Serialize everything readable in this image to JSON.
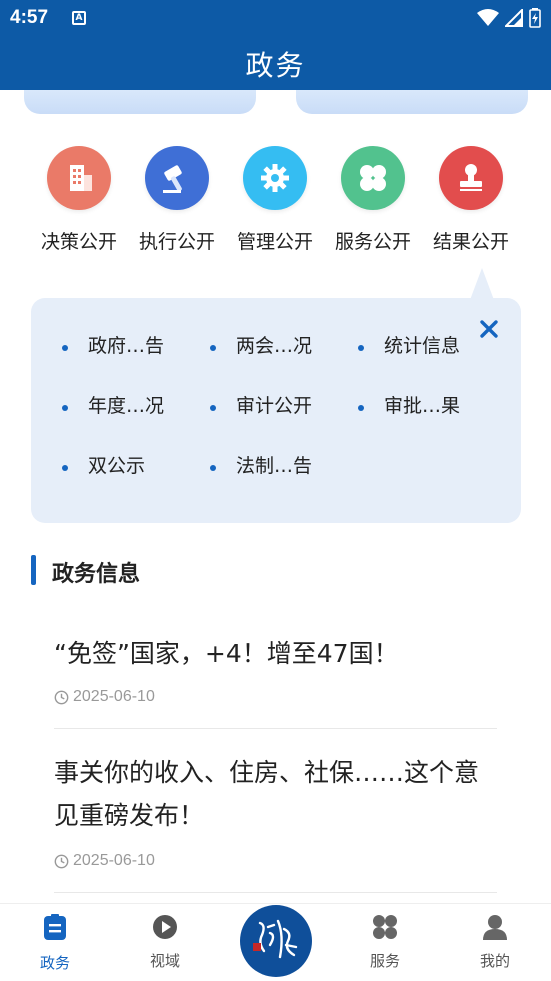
{
  "status_bar": {
    "time": "4:57",
    "a_badge": "A"
  },
  "header": {
    "title": "政务"
  },
  "nav_items": [
    {
      "label": "决策公开",
      "icon": "building-icon",
      "color": "#e96c5c"
    },
    {
      "label": "执行公开",
      "icon": "gavel-icon",
      "color": "#3f6fd6"
    },
    {
      "label": "管理公开",
      "icon": "gear-icon",
      "color": "#33b8f0"
    },
    {
      "label": "服务公开",
      "icon": "clover-icon",
      "color": "#4fbf8a"
    },
    {
      "label": "结果公开",
      "icon": "stamp-icon",
      "color": "#e04848"
    }
  ],
  "panel": {
    "items": [
      "政府…告",
      "两会…况",
      "统计信息",
      "年度…况",
      "审计公开",
      "审批…果",
      "双公示",
      "法制…告"
    ]
  },
  "section": {
    "title": "政务信息"
  },
  "news": [
    {
      "title": "“免签”国家，+4！增至47国！",
      "date": "2025-06-10"
    },
    {
      "title": "事关你的收入、住房、社保……这个意见重磅发布！",
      "date": "2025-06-10"
    }
  ],
  "bottom_nav": {
    "tabs": [
      {
        "label": "政务",
        "icon": "document-icon",
        "active": true
      },
      {
        "label": "视域",
        "icon": "play-icon",
        "active": false
      },
      {
        "label": "服务",
        "icon": "grid-icon",
        "active": false
      },
      {
        "label": "我的",
        "icon": "person-icon",
        "active": false
      }
    ],
    "center_logo": "logo"
  }
}
